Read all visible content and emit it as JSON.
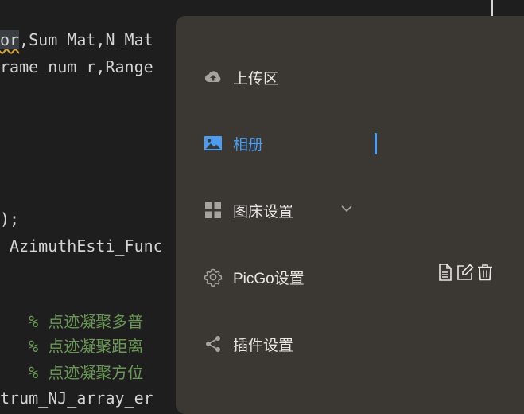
{
  "editor": {
    "lines": [
      {
        "pre": "",
        "highlight": "or",
        "post": ",Sum_Mat,N_Mat"
      },
      {
        "pre": "rame_num_r,Range",
        "highlight": "",
        "post": ""
      },
      {
        "pre": ");",
        "highlight": "",
        "post": ""
      },
      {
        "pre": " AzimuthEsti_Func",
        "highlight": "",
        "post": ""
      },
      {
        "pre": "   % 点迹凝聚多普",
        "highlight": "",
        "post": ""
      },
      {
        "pre": "   % 点迹凝聚距离",
        "highlight": "",
        "post": ""
      },
      {
        "pre": "   % 点迹凝聚方位",
        "highlight": "",
        "post": ""
      },
      {
        "pre": "trum_NJ_array_er",
        "highlight": "",
        "post": ""
      }
    ]
  },
  "menu": {
    "items": [
      {
        "label": "上传区",
        "icon": "cloud-upload-icon"
      },
      {
        "label": "相册",
        "icon": "image-icon"
      },
      {
        "label": "图床设置",
        "icon": "grid-icon"
      },
      {
        "label": "PicGo设置",
        "icon": "gear-icon"
      },
      {
        "label": "插件设置",
        "icon": "share-icon"
      }
    ],
    "active_index": 1
  },
  "colors": {
    "panel_bg": "#3b3834",
    "accent": "#4a9df1",
    "editor_bg": "#1e1e1e",
    "comment": "#6a9955"
  }
}
